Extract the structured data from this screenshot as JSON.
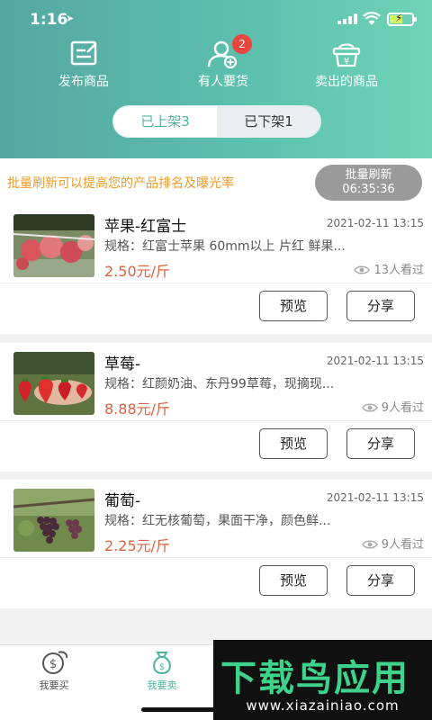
{
  "status_bar": {
    "time": "1:16"
  },
  "top_nav": [
    {
      "label": "发布商品",
      "icon": "edit-icon"
    },
    {
      "label": "有人要货",
      "icon": "user-add-icon",
      "badge": "2"
    },
    {
      "label": "卖出的商品",
      "icon": "basket-yen-icon"
    }
  ],
  "segment": {
    "on_shelf": "已上架3",
    "off_shelf": "已下架1"
  },
  "notice": {
    "text": "批量刷新可以提高您的产品排名及曝光率",
    "refresh_label": "批量刷新",
    "refresh_time": "06:35:36"
  },
  "products": [
    {
      "title": "苹果-红富士",
      "date": "2021-02-11 13:15",
      "spec": "规格：红富士苹果 60mm以上 片红 鲜果...",
      "price": "2.50元/斤",
      "views": "13人看过",
      "preview": "预览",
      "share": "分享"
    },
    {
      "title": "草莓-",
      "date": "2021-02-11 13:15",
      "spec": "规格：红颜奶油、东丹99草莓，现摘现...",
      "price": "8.88元/斤",
      "views": "9人看过",
      "preview": "预览",
      "share": "分享"
    },
    {
      "title": "葡萄-",
      "date": "2021-02-11 13:15",
      "spec": "规格：红无核葡萄，果面干净，颜色鲜...",
      "price": "2.25元/斤",
      "views": "9人看过",
      "preview": "预览",
      "share": "分享"
    }
  ],
  "tab_bar": [
    {
      "label": "我要买",
      "icon": "dollar-coin-icon"
    },
    {
      "label": "我要卖",
      "icon": "money-bag-icon"
    }
  ],
  "watermark": {
    "title": "下载鸟应用",
    "url": "www.xiazainiao.com"
  },
  "colors": {
    "accent": "#4fb3a1",
    "price": "#d9643d",
    "notice": "#f09a27",
    "badge": "#e8463f"
  }
}
